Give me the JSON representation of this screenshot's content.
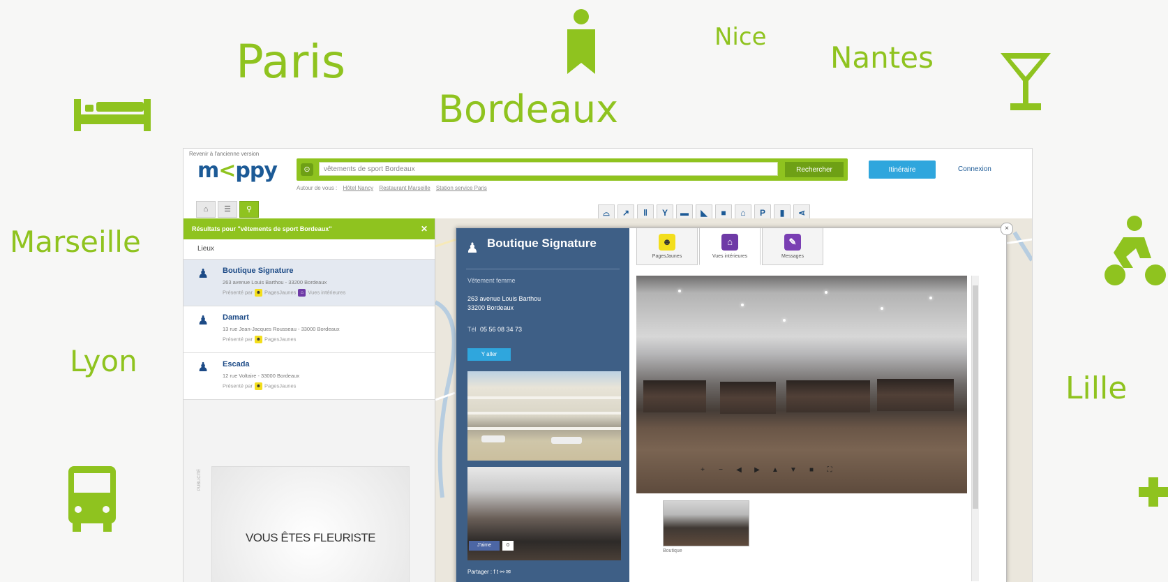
{
  "cities": {
    "paris": "Paris",
    "bordeaux": "Bordeaux",
    "nice": "Nice",
    "nantes": "Nantes",
    "marseille": "Marseille",
    "lyon": "Lyon",
    "lille": "Lille"
  },
  "app": {
    "old_version_link": "Revenir à l'ancienne version",
    "logo": "mappy"
  },
  "search": {
    "value": "vêtements de sport Bordeaux",
    "button": "Rechercher",
    "suggestions_label": "Autour de vous :",
    "suggestions": [
      "Hôtel Nancy",
      "Restaurant Marseille",
      "Station service Paris"
    ]
  },
  "header": {
    "itinerary_button": "Itinéraire",
    "login_link": "Connexion"
  },
  "results": {
    "header": "Résultats pour \"vêtements de sport Bordeaux\"",
    "close": "✕",
    "section_label": "Lieux",
    "places": [
      {
        "name": "Boutique Signature",
        "address": "263 avenue Louis Barthou - 33200 Bordeaux",
        "presented_by": "Présenté par",
        "partner": "PagesJaunes",
        "extra": "Vues intérieures"
      },
      {
        "name": "Damart",
        "address": "13 rue Jean-Jacques Rousseau - 33000 Bordeaux",
        "presented_by": "Présenté par",
        "partner": "PagesJaunes"
      },
      {
        "name": "Escada",
        "address": "12 rue Voltaire - 33000 Bordeaux",
        "presented_by": "Présenté par",
        "partner": "PagesJaunes"
      }
    ]
  },
  "ad": {
    "label": "PUBLICITÉ",
    "text": "VOUS ÊTES FLEURISTE"
  },
  "card": {
    "title": "Boutique Signature",
    "category": "Vêtement femme",
    "address_line1": "263 avenue Louis Barthou",
    "address_line2": "33200 Bordeaux",
    "phone_label": "Tél",
    "phone": "05 56 08 34 73",
    "follow": "Y aller",
    "fb_like": "J'aime",
    "fb_count": "0",
    "share": "Partager :",
    "tabs": [
      {
        "label": "PagesJaunes",
        "icon": "pagesjaunes-icon"
      },
      {
        "label": "Vues intérieures",
        "icon": "interior-views-icon"
      },
      {
        "label": "Messages",
        "icon": "messages-icon"
      }
    ],
    "thumb_caption": "Boutique"
  },
  "colors": {
    "accent": "#8fc31f",
    "brand_blue": "#1c5a96",
    "card_blue": "#3e5f86",
    "itinerary_blue": "#2fa6dd"
  }
}
